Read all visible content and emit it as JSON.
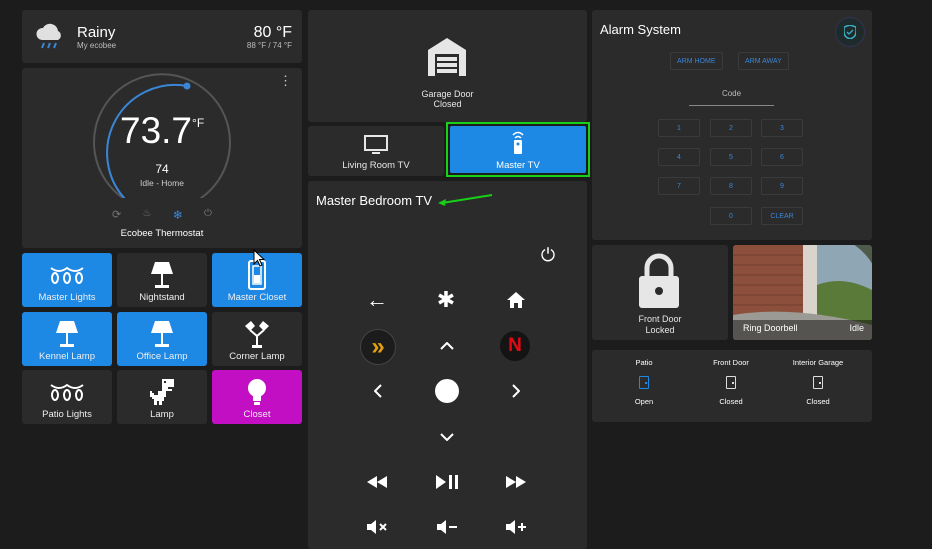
{
  "weather": {
    "condition": "Rainy",
    "location": "My ecobee",
    "temp": "80 °F",
    "range": "88 °F / 74 °F"
  },
  "thermostat": {
    "current": "73.7",
    "unit": "°F",
    "target": "74",
    "status": "Idle - Home",
    "name": "Ecobee Thermostat",
    "menu_glyph": "⋮",
    "mode_icons": [
      "sync-icon",
      "fire-icon",
      "snowflake-icon",
      "power-icon"
    ],
    "active_mode": "snowflake-icon",
    "accent": "#3a86d6"
  },
  "tiles": [
    {
      "label": "Master Lights",
      "icon": "string-lights-icon",
      "color": "#1e88e5",
      "active": true
    },
    {
      "label": "Nightstand",
      "icon": "lamp-icon",
      "color": "#2b2b2b",
      "active": false
    },
    {
      "label": "Master Closet",
      "icon": "switch-icon",
      "color": "#1e88e5",
      "active": true
    },
    {
      "label": "Kennel Lamp",
      "icon": "lamp-icon",
      "color": "#1e88e5",
      "active": true
    },
    {
      "label": "Office Lamp",
      "icon": "lamp-icon",
      "color": "#1e88e5",
      "active": true
    },
    {
      "label": "Corner Lamp",
      "icon": "floor-lamp-icon",
      "color": "#2b2b2b",
      "active": false
    },
    {
      "label": "Patio Lights",
      "icon": "string-lights-icon",
      "color": "#2b2b2b",
      "active": false
    },
    {
      "label": "Lamp",
      "icon": "dino-icon",
      "color": "#2b2b2b",
      "active": false
    },
    {
      "label": "Closet",
      "icon": "bulb-icon",
      "color": "#c30fc3",
      "active": true
    }
  ],
  "garage": {
    "label": "Garage Door",
    "state": "Closed"
  },
  "tv_buttons": [
    {
      "label": "Living Room TV",
      "icon": "tv-icon",
      "active": false
    },
    {
      "label": "Master TV",
      "icon": "remote-icon",
      "active": true,
      "highlight": "#17d017"
    }
  ],
  "remote": {
    "title": "Master Bedroom TV",
    "symbols": {
      "back": "←",
      "star": "✱",
      "home": "⌂",
      "up": "⌃",
      "left": "‹",
      "right": "›",
      "down": "⌄",
      "rewind": "◂◂",
      "playpause": "▸❚❚",
      "forward": "▸▸"
    },
    "apps": [
      {
        "name": "plex-icon",
        "glyph": "»"
      },
      {
        "name": "netflix-icon",
        "glyph": "N"
      }
    ]
  },
  "alarm": {
    "title": "Alarm System",
    "arm_home": "ARM HOME",
    "arm_away": "ARM AWAY",
    "code_label": "Code",
    "keys": [
      "1",
      "2",
      "3",
      "4",
      "5",
      "6",
      "7",
      "8",
      "9"
    ],
    "zero": "0",
    "clear": "CLEAR"
  },
  "front_door": {
    "label": "Front Door",
    "state": "Locked"
  },
  "doorbell": {
    "label": "Ring Doorbell",
    "state": "Idle"
  },
  "doors": [
    {
      "name": "Patio",
      "state": "Open",
      "active": true
    },
    {
      "name": "Front Door",
      "state": "Closed",
      "active": false
    },
    {
      "name": "Interior Garage",
      "state": "Closed",
      "active": false
    }
  ]
}
